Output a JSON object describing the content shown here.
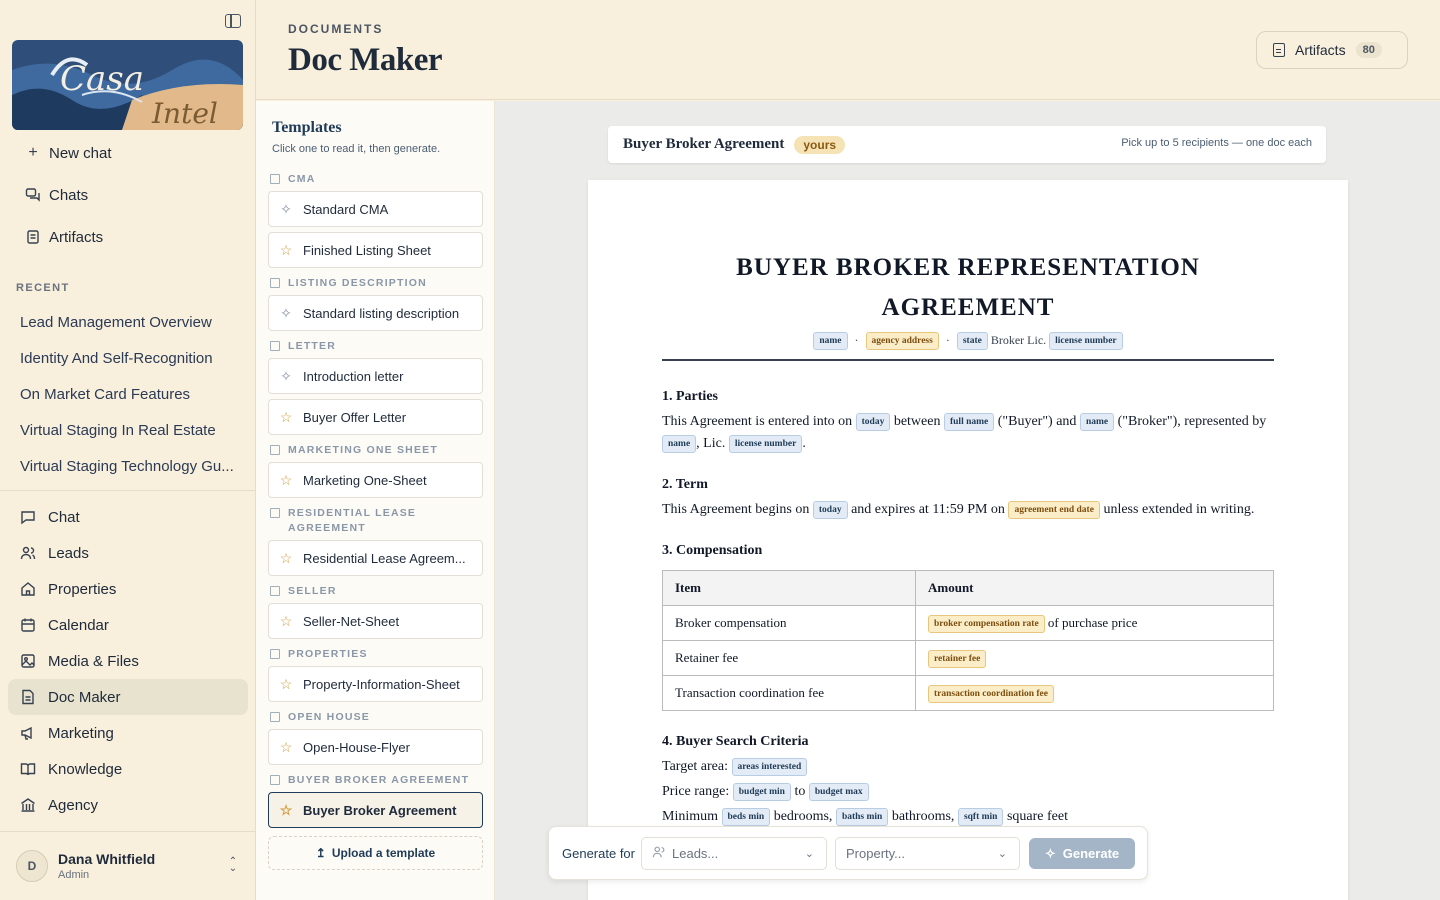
{
  "logo": {
    "text_top": "Casa",
    "text_bottom": "Intel"
  },
  "nav_top": [
    {
      "label": "New chat",
      "icon": "plus-icon"
    },
    {
      "label": "Chats",
      "icon": "chats-icon"
    },
    {
      "label": "Artifacts",
      "icon": "artifacts-icon"
    }
  ],
  "recent": {
    "heading": "RECENT",
    "items": [
      "Lead Management Overview",
      "Identity And Self-Recognition",
      "On Market Card Features",
      "Virtual Staging In Real Estate",
      "Virtual Staging Technology Gu..."
    ]
  },
  "nav_main": [
    {
      "label": "Chat",
      "icon": "chat-icon"
    },
    {
      "label": "Leads",
      "icon": "users-icon"
    },
    {
      "label": "Properties",
      "icon": "home-icon"
    },
    {
      "label": "Calendar",
      "icon": "calendar-icon"
    },
    {
      "label": "Media & Files",
      "icon": "image-icon"
    },
    {
      "label": "Doc Maker",
      "icon": "document-icon",
      "active": true
    },
    {
      "label": "Marketing",
      "icon": "megaphone-icon"
    },
    {
      "label": "Knowledge",
      "icon": "book-icon"
    },
    {
      "label": "Agency",
      "icon": "building-icon"
    }
  ],
  "user": {
    "initial": "D",
    "name": "Dana Whitfield",
    "role": "Admin"
  },
  "header": {
    "crumb": "DOCUMENTS",
    "title": "Doc Maker",
    "artifacts_label": "Artifacts",
    "artifacts_count": "80"
  },
  "templates": {
    "title": "Templates",
    "subtitle": "Click one to read it, then generate.",
    "groups": [
      {
        "category": "CMA",
        "items": [
          {
            "label": "Standard CMA",
            "icon": "sparkle-icon"
          },
          {
            "label": "Finished Listing Sheet",
            "icon": "star-icon"
          }
        ]
      },
      {
        "category": "LISTING DESCRIPTION",
        "items": [
          {
            "label": "Standard listing description",
            "icon": "sparkle-icon"
          }
        ]
      },
      {
        "category": "LETTER",
        "items": [
          {
            "label": "Introduction letter",
            "icon": "sparkle-icon"
          },
          {
            "label": "Buyer Offer Letter",
            "icon": "star-icon"
          }
        ]
      },
      {
        "category": "MARKETING ONE SHEET",
        "items": [
          {
            "label": "Marketing One-Sheet",
            "icon": "star-icon"
          }
        ]
      },
      {
        "category": "RESIDENTIAL LEASE AGREEMENT",
        "items": [
          {
            "label": "Residential Lease Agreem...",
            "icon": "star-icon"
          }
        ]
      },
      {
        "category": "SELLER",
        "items": [
          {
            "label": "Seller-Net-Sheet",
            "icon": "star-icon"
          }
        ]
      },
      {
        "category": "PROPERTIES",
        "items": [
          {
            "label": "Property-Information-Sheet",
            "icon": "star-icon"
          }
        ]
      },
      {
        "category": "OPEN HOUSE",
        "items": [
          {
            "label": "Open-House-Flyer",
            "icon": "star-icon"
          }
        ]
      },
      {
        "category": "BUYER BROKER AGREEMENT",
        "items": [
          {
            "label": "Buyer Broker Agreement",
            "icon": "star-icon",
            "selected": true
          }
        ]
      }
    ],
    "upload_label": "Upload a template"
  },
  "docbar": {
    "name": "Buyer Broker Agreement",
    "badge": "yours",
    "hint": "Pick up to 5 recipients — one doc each"
  },
  "doc": {
    "title_line1": "BUYER BROKER REPRESENTATION",
    "title_line2": "AGREEMENT",
    "meta": {
      "t1": "name",
      "dot": "·",
      "t2": "agency address",
      "t3": "state",
      "broker_lic": "Broker Lic.",
      "t4": "license number"
    },
    "s1": {
      "heading": "1. Parties",
      "p1": "This Agreement is entered into on",
      "t_today": "today",
      "p2": "between",
      "t_fullname": "full name",
      "p3": "(\"Buyer\") and",
      "t_name": "name",
      "p4": "(\"Broker\"), represented by",
      "t_name2": "name",
      "p5": ", Lic.",
      "t_lic": "license number",
      "p6": "."
    },
    "s2": {
      "heading": "2. Term",
      "p1": "This Agreement begins on",
      "t_today": "today",
      "p2": "and expires at 11:59 PM on",
      "t_end": "agreement end date",
      "p3": "unless extended in writing."
    },
    "s3": {
      "heading": "3. Compensation",
      "col_item": "Item",
      "col_amount": "Amount",
      "rows": [
        {
          "item": "Broker compensation",
          "token": "broker compensation rate",
          "suffix": "of purchase price"
        },
        {
          "item": "Retainer fee",
          "token": "retainer fee",
          "suffix": ""
        },
        {
          "item": "Transaction coordination fee",
          "token": "transaction coordination fee",
          "suffix": ""
        }
      ]
    },
    "s4": {
      "heading": "4. Buyer Search Criteria",
      "target_label": "Target area:",
      "t_areas": "areas interested",
      "price_label": "Price range:",
      "t_bmin": "budget min",
      "to": "to",
      "t_bmax": "budget max",
      "min_label": "Minimum",
      "t_beds": "beds min",
      "bedrooms": "bedrooms,",
      "t_baths": "baths min",
      "bathrooms": "bathrooms,",
      "t_sqft": "sqft min",
      "sqft": "square feet"
    }
  },
  "genbar": {
    "label": "Generate for",
    "leads_placeholder": "Leads...",
    "property_placeholder": "Property...",
    "button": "Generate"
  }
}
